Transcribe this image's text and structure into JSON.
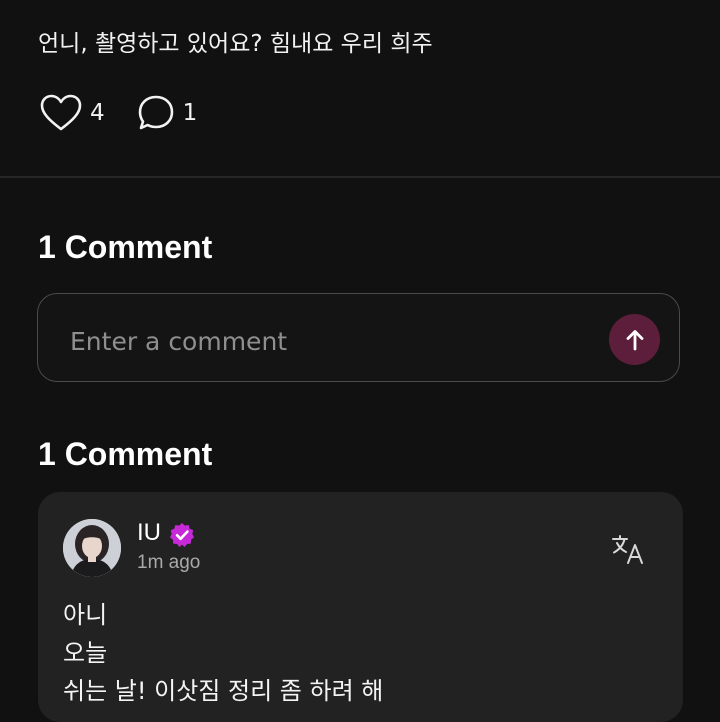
{
  "post": {
    "text": "언니, 촬영하고 있어요? 힘내요 우리 희주",
    "likes": "4",
    "comments": "1"
  },
  "comment_section": {
    "title": "1 Comment",
    "input_placeholder": "Enter a comment",
    "list_title": "1 Comment"
  },
  "comment": {
    "author": "IU",
    "time": "1m ago",
    "lines": [
      "아니",
      "오늘",
      "쉬는 날! 이삿짐 정리 좀 하려 해"
    ]
  },
  "colors": {
    "background": "#111111",
    "card": "#222222",
    "accent": "#c62ad8",
    "send_button": "#5c1e3a"
  },
  "icons": {
    "like": "heart-icon",
    "comment": "speech-bubble-icon",
    "send": "arrow-up-icon",
    "verified": "verified-badge-icon",
    "translate": "translate-icon"
  }
}
